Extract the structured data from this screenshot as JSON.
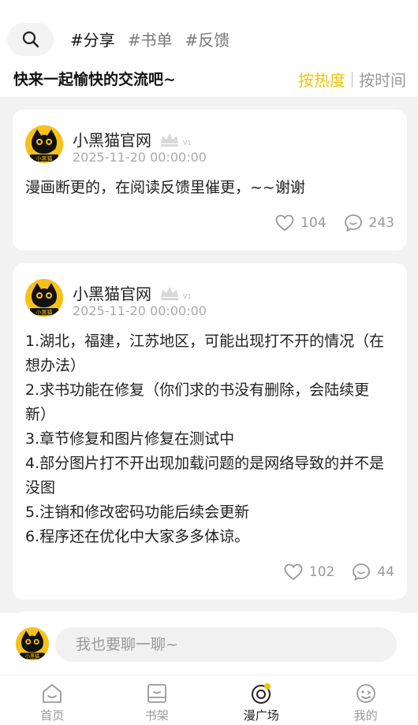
{
  "header": {
    "tags": [
      "#分享",
      "#书单",
      "#反馈"
    ],
    "slogan": "快来一起愉快的交流吧~",
    "sort_hot": "按热度",
    "sort_time": "按时间"
  },
  "posts": [
    {
      "author": "小黑猫官网",
      "level": "V1",
      "avatar_text": "小黑猫",
      "date": "2025-11-20 00:00:00",
      "content": "漫画断更的，在阅读反馈里催更，~~谢谢",
      "likes": "104",
      "comments": "243"
    },
    {
      "author": "小黑猫官网",
      "level": "V1",
      "avatar_text": "小黑猫",
      "date": "2025-11-20 00:00:00",
      "content": "1.湖北，福建，江苏地区，可能出现打不开的情况（在想办法）\n2.求书功能在修复（你们求的书没有删除，会陆续更新）\n3.章节修复和图片修复在测试中\n4.部分图片打不开出现加载问题的是网络导致的并不是没图\n5.注销和修改密码功能后续会更新\n6.程序还在优化中大家多多体谅。",
      "likes": "102",
      "comments": "44"
    }
  ],
  "compose": {
    "placeholder": "我也要聊一聊~",
    "avatar_text": "小黑猫"
  },
  "tabbar": {
    "items": [
      {
        "label": "首页",
        "icon": "home-icon"
      },
      {
        "label": "书架",
        "icon": "bookshelf-icon"
      },
      {
        "label": "漫广场",
        "icon": "square-icon"
      },
      {
        "label": "我的",
        "icon": "profile-icon"
      }
    ],
    "active_index": 2
  },
  "colors": {
    "accent": "#f3c300",
    "avatar_bg": "#f6c11b"
  }
}
